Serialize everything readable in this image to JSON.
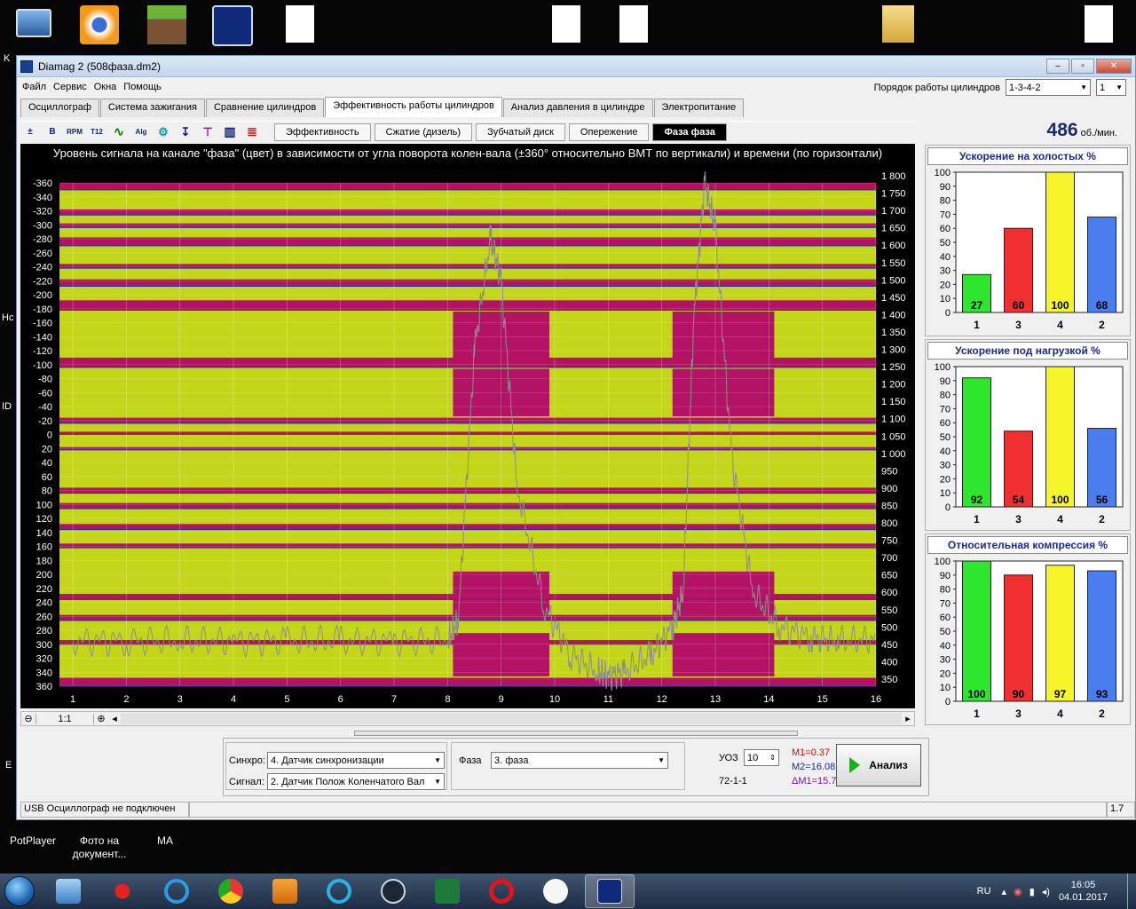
{
  "desktop": {
    "edge_labels": [
      "K",
      "Hc",
      "ID",
      "E"
    ],
    "bottom_icons": [
      {
        "name": "potplayer-icon",
        "label": "PotPlayer"
      },
      {
        "name": "photo-doc-icon",
        "label": "Фото на документ..."
      },
      {
        "name": "ma-icon",
        "label": "MA"
      }
    ]
  },
  "window": {
    "title": "Diamag 2 (508фаза.dm2)",
    "buttons": [
      "–",
      "▫",
      "✕"
    ],
    "menu": [
      "Файл",
      "Сервис",
      "Окна",
      "Помощь"
    ],
    "cylinder_order_label": "Порядок работы цилиндров",
    "cylinder_order_value": "1-3-4-2",
    "cylinder_order_spin": "1",
    "tabs": [
      {
        "label": "Осциллограф",
        "active": false
      },
      {
        "label": "Система зажигания",
        "active": false
      },
      {
        "label": "Сравнение цилиндров",
        "active": false
      },
      {
        "label": "Эффективность работы цилиндров",
        "active": true
      },
      {
        "label": "Анализ давления в цилиндре",
        "active": false
      },
      {
        "label": "Электропитание",
        "active": false
      }
    ],
    "subtabs": [
      {
        "label": "Эффективность",
        "active": false
      },
      {
        "label": "Сжатие (дизель)",
        "active": false
      },
      {
        "label": "Зубчатый диск",
        "active": false
      },
      {
        "label": "Опережение",
        "active": false
      },
      {
        "label": "Фаза фаза",
        "active": true
      }
    ],
    "toolbar_icons": [
      "fit-icon",
      "bold-icon",
      "rpm-icon",
      "t12-icon",
      "curve-icon",
      "alg-icon",
      "cylinder-icon",
      "cursor-icon",
      "marker-icon",
      "barchart-icon",
      "table-icon"
    ],
    "toolbar_icon_text": [
      "±",
      "B",
      "RPM",
      "T12",
      "∿",
      "Alg",
      "⚙",
      "↧",
      "⊤",
      "▥",
      "≣"
    ],
    "rpm_value": "486",
    "rpm_unit": "об./мин."
  },
  "chart_data": {
    "type": "heatmap",
    "title": "Уровень сигнала на канале \"фаза\" (цвет) в зависимости от угла поворота колен-вала (±360° относительно ВМТ по вертикали) и времени (по горизонтали)",
    "y_left_ticks": [
      "-360",
      "-340",
      "-320",
      "-300",
      "-280",
      "-260",
      "-240",
      "-220",
      "-200",
      "-180",
      "-160",
      "-140",
      "-120",
      "-100",
      "-80",
      "-60",
      "-40",
      "-20",
      "0",
      "20",
      "40",
      "60",
      "80",
      "100",
      "120",
      "140",
      "160",
      "180",
      "200",
      "220",
      "240",
      "260",
      "280",
      "300",
      "320",
      "340",
      "360"
    ],
    "y_left_range": [
      -360,
      360
    ],
    "y_right_ticks": [
      "1 800",
      "1 750",
      "1 700",
      "1 650",
      "1 600",
      "1 550",
      "1 500",
      "1 450",
      "1 400",
      "1 350",
      "1 300",
      "1 250",
      "1 200",
      "1 150",
      "1 100",
      "1 050",
      "1 000",
      "950",
      "900",
      "850",
      "800",
      "750",
      "700",
      "650",
      "600",
      "550",
      "500",
      "450",
      "400",
      "350"
    ],
    "y_right_range": [
      350,
      1800
    ],
    "x_ticks": [
      "1",
      "2",
      "3",
      "4",
      "5",
      "6",
      "7",
      "8",
      "9",
      "10",
      "11",
      "12",
      "13",
      "14",
      "15",
      "16"
    ],
    "x_range": [
      1,
      16
    ],
    "colors": {
      "high": "#c4d61a",
      "low": "#b31265",
      "trace": "#8d8d8d",
      "edge": "#0a3aa8"
    },
    "bands_low_deg": [
      [
        -360,
        -350
      ],
      [
        -322,
        -314
      ],
      [
        -302,
        -296
      ],
      [
        -282,
        -270
      ],
      [
        -244,
        -238
      ],
      [
        -222,
        -212
      ],
      [
        -192,
        -178
      ],
      [
        -110,
        -96
      ],
      [
        -24,
        -16
      ],
      [
        -4,
        0
      ],
      [
        18,
        22
      ],
      [
        76,
        84
      ],
      [
        98,
        106
      ],
      [
        128,
        136
      ],
      [
        156,
        162
      ],
      [
        228,
        236
      ],
      [
        258,
        266
      ],
      [
        294,
        300
      ],
      [
        348,
        360
      ]
    ],
    "rpm_trace": {
      "x": [
        1,
        2,
        3,
        4,
        5,
        6,
        7,
        8,
        8.2,
        8.5,
        8.8,
        9.0,
        9.3,
        9.8,
        10.3,
        10.8,
        11.0,
        11.3,
        11.8,
        12.2,
        12.4,
        12.6,
        12.8,
        13.0,
        13.3,
        13.7,
        14.2,
        14.8,
        15.3,
        16
      ],
      "rpm": [
        460,
        460,
        460,
        460,
        460,
        460,
        460,
        460,
        520,
        1300,
        1620,
        1500,
        900,
        560,
        420,
        370,
        360,
        370,
        420,
        500,
        600,
        1400,
        1780,
        1650,
        1000,
        600,
        500,
        470,
        460,
        465
      ]
    },
    "zones": [
      {
        "x_start": 8.1,
        "x_end": 9.9
      },
      {
        "x_start": 12.2,
        "x_end": 14.1
      }
    ]
  },
  "scrollbar": {
    "zoom": "1:1",
    "minus": "⊖",
    "plus": "⊕",
    "left": "◂",
    "right": "▸"
  },
  "controls": {
    "sync_label": "Синхро:",
    "sync_value": "4.  Датчик синхронизации",
    "signal_label": "Сигнал:",
    "signal_value": "2.  Датчик Полож Коленчатого Вал",
    "phase_label": "Фаза",
    "phase_value": "3.  фаза",
    "uoz_label": "УОЗ",
    "uoz_value": "10",
    "code": "72-1-1",
    "m1": "M1=0.37",
    "m2": "M2=16.08",
    "dm": "ΔM1=15.71",
    "analyze": "Анализ"
  },
  "status": {
    "left": "USB Осциллограф не подключен",
    "right": "1.7"
  },
  "side_charts": [
    {
      "title": "Ускорение на холостых %",
      "type": "bar",
      "categories": [
        "1",
        "3",
        "4",
        "2"
      ],
      "values": [
        27,
        60,
        100,
        68
      ],
      "ylim": [
        0,
        100
      ],
      "ticks": [
        "0",
        "10",
        "20",
        "30",
        "40",
        "50",
        "60",
        "70",
        "80",
        "90",
        "100"
      ],
      "colors": [
        "#2ee62e",
        "#f03030",
        "#f5f52a",
        "#4a7df0"
      ]
    },
    {
      "title": "Ускорение под нагрузкой %",
      "type": "bar",
      "categories": [
        "1",
        "3",
        "4",
        "2"
      ],
      "values": [
        92,
        54,
        100,
        56
      ],
      "ylim": [
        0,
        100
      ],
      "ticks": [
        "0",
        "10",
        "20",
        "30",
        "40",
        "50",
        "60",
        "70",
        "80",
        "90",
        "100"
      ],
      "colors": [
        "#2ee62e",
        "#f03030",
        "#f5f52a",
        "#4a7df0"
      ]
    },
    {
      "title": "Относительная компрессия %",
      "type": "bar",
      "categories": [
        "1",
        "3",
        "4",
        "2"
      ],
      "values": [
        100,
        90,
        97,
        93
      ],
      "ylim": [
        0,
        100
      ],
      "ticks": [
        "0",
        "10",
        "20",
        "30",
        "40",
        "50",
        "60",
        "70",
        "80",
        "90",
        "100"
      ],
      "colors": [
        "#2ee62e",
        "#f03030",
        "#f5f52a",
        "#4a7df0"
      ]
    }
  ],
  "taskbar": {
    "apps": [
      "explorer-icon",
      "paint-icon",
      "ie-icon",
      "chrome-icon",
      "media-icon",
      "mail-icon",
      "steam-icon",
      "excel-icon",
      "opera-icon",
      "yandex-icon",
      "diamag-icon"
    ],
    "lang": "RU",
    "time": "16:05",
    "date": "04.01.2017"
  }
}
